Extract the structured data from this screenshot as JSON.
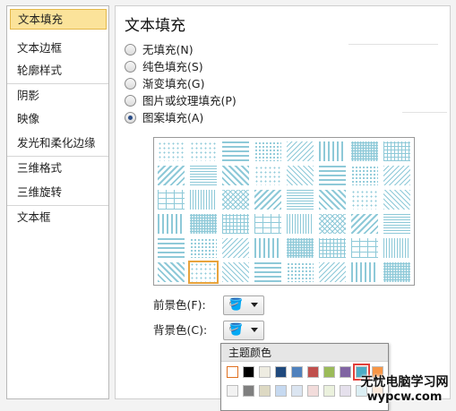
{
  "sidebar": {
    "items": [
      {
        "label": "文本填充",
        "active": true
      },
      {
        "label": "文本边框"
      },
      {
        "label": "轮廓样式"
      },
      {
        "label": "阴影"
      },
      {
        "label": "映像"
      },
      {
        "label": "发光和柔化边缘"
      },
      {
        "label": "三维格式"
      },
      {
        "label": "三维旋转"
      },
      {
        "label": "文本框"
      }
    ]
  },
  "panel": {
    "title": "文本填充",
    "fill_options": [
      {
        "label": "无填充(N)",
        "selected": false
      },
      {
        "label": "纯色填充(S)",
        "selected": false
      },
      {
        "label": "渐变填充(G)",
        "selected": false
      },
      {
        "label": "图片或纹理填充(P)",
        "selected": false
      },
      {
        "label": "图案填充(A)",
        "selected": true
      }
    ],
    "pattern_grid": {
      "columns": 8,
      "rows": 6,
      "selected_index": 41,
      "pattern_color": "#8ec9d8"
    },
    "foreground": {
      "label": "前景色(F):",
      "icon": "paint-bucket-icon"
    },
    "background": {
      "label": "背景色(C):",
      "icon": "paint-bucket-icon"
    }
  },
  "color_popup": {
    "header": "主题颜色",
    "theme_colors": [
      "#ffffff",
      "#000000",
      "#eeece1",
      "#1f497d",
      "#4f81bd",
      "#c0504d",
      "#9bbb59",
      "#8064a2",
      "#4bacc6",
      "#f79646"
    ],
    "tint_row": [
      "#f2f2f2",
      "#7f7f7f",
      "#ddd9c3",
      "#c6d9f0",
      "#dbe5f1",
      "#f2dcdb",
      "#ebf1dd",
      "#e5e0ec",
      "#dbeef3",
      "#fdeada"
    ],
    "selected_index": 8
  },
  "watermark": {
    "line1": "无忧电脑学习网",
    "line2": "wypcw.com"
  }
}
